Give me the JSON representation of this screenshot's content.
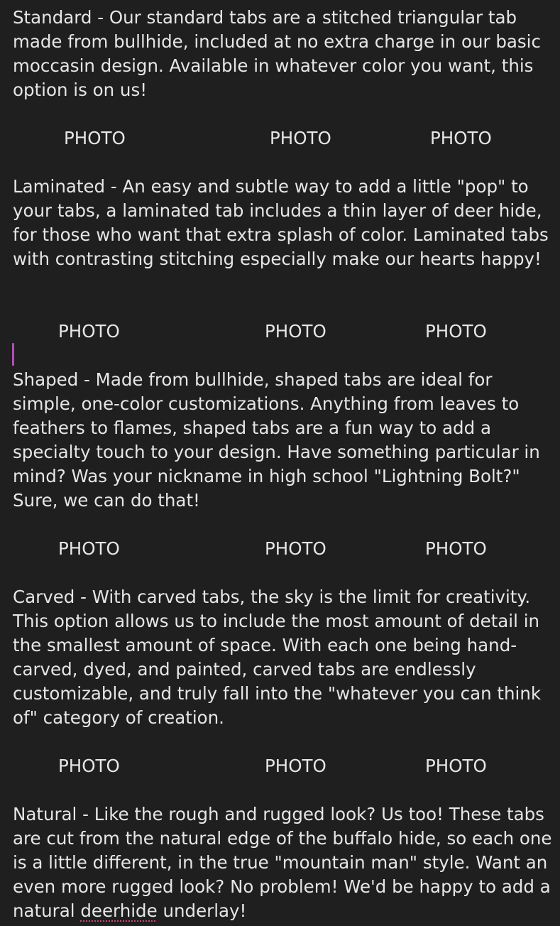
{
  "sections": [
    {
      "name": "standard",
      "text": "Standard - Our standard tabs are a stitched triangular tab made from bullhide, included at no extra charge in our basic moccasin design. Available in whatever color you want, this option is on us!"
    },
    {
      "name": "laminated",
      "text": "Laminated - An easy and subtle way to add a little \"pop\" to your tabs, a laminated tab includes a thin layer of deer hide, for those who want that extra splash of color. Laminated tabs with contrasting stitching especially make our hearts happy!"
    },
    {
      "name": "shaped",
      "text": "Shaped - Made from bullhide, shaped tabs are ideal for simple, one-color customizations. Anything from leaves to feathers to flames, shaped tabs are a fun way to add a specialty touch to your design. Have something particular in mind? Was your nickname in high school \"Lightning Bolt?\" Sure, we can do that!"
    },
    {
      "name": "carved",
      "text": "Carved - With carved tabs, the sky is the limit for creativity. This option allows us to include the most amount of detail in the smallest amount of space. With each one being hand-carved, dyed, and painted, carved tabs are endlessly customizable, and truly fall into the \"whatever you can think of\" category of creation."
    },
    {
      "name": "natural",
      "text_before": "Natural - Like the rough and rugged look? Us too! These tabs are cut from the natural edge of the buffalo hide, so each one is a little different, in the true \"mountain man\" style. Want an even more rugged look? No problem! We'd be happy to add a natural ",
      "misspelled_word": "deerhide",
      "text_after": " underlay!"
    }
  ],
  "photo_label": "PHOTO",
  "photo_rows": [
    [
      "PHOTO",
      "PHOTO",
      "PHOTO"
    ],
    [
      "PHOTO",
      "PHOTO",
      "PHOTO"
    ],
    [
      "PHOTO",
      "PHOTO",
      "PHOTO"
    ],
    [
      "PHOTO",
      "PHOTO",
      "PHOTO"
    ]
  ],
  "colors": {
    "background": "#1f1f20",
    "text": "#e6e6e6",
    "caret": "#b24fb4",
    "spellcheck_underline": "#c94b6b"
  }
}
